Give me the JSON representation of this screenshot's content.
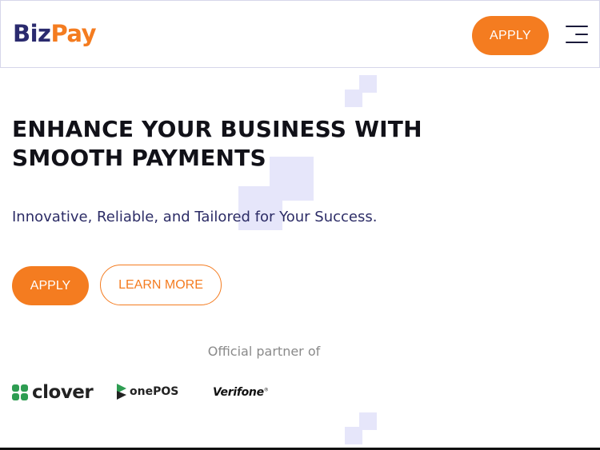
{
  "header": {
    "logo_part1": "Biz",
    "logo_part2": "Pay",
    "apply_label": "APPLY",
    "menu_icon": "hamburger-menu-icon"
  },
  "hero": {
    "headline_line1": "ENHANCE YOUR BUSINESS WITH",
    "headline_line2": "SMOOTH PAYMENTS",
    "subtitle": "Innovative, Reliable, and Tailored for Your Success.",
    "apply_label": "APPLY",
    "learn_more_label": "LEARN MORE"
  },
  "partners": {
    "heading": "Official partner of",
    "logos": [
      {
        "name": "clover",
        "text": "clover",
        "icon": "clover-logo-icon"
      },
      {
        "name": "onepos",
        "text": "onePOS",
        "icon": "onepos-logo-icon"
      },
      {
        "name": "verifone",
        "text": "Verifone",
        "icon": "verifone-logo-icon"
      }
    ]
  },
  "colors": {
    "brand_navy": "#2a2a6e",
    "brand_orange": "#f47c20",
    "decor_lavender": "#e6e6fa",
    "clover_green": "#2e9d52"
  }
}
